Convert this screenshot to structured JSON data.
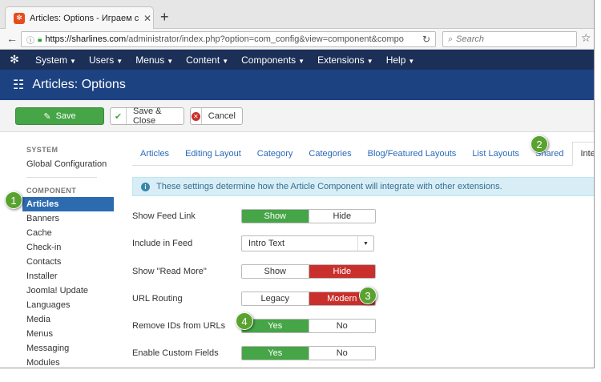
{
  "browser": {
    "tab_title": "Articles: Options - Играем с",
    "tab_icon": "joomla-favicon",
    "new_tab": "+",
    "url_host": "https://sharlines.com",
    "url_path": "/administrator/index.php?option=com_config&view=component&compo",
    "search_placeholder": "Search"
  },
  "menu": {
    "items": [
      "System",
      "Users",
      "Menus",
      "Content",
      "Components",
      "Extensions",
      "Help"
    ]
  },
  "header": {
    "title": "Articles: Options"
  },
  "toolbar": {
    "save_label": "Save",
    "save_close_label": "Save & Close",
    "cancel_label": "Cancel"
  },
  "sidebar": {
    "system_heading": "SYSTEM",
    "global_config": "Global Configuration",
    "component_heading": "COMPONENT",
    "items": [
      "Articles",
      "Banners",
      "Cache",
      "Check-in",
      "Contacts",
      "Installer",
      "Joomla! Update",
      "Languages",
      "Media",
      "Menus",
      "Messaging",
      "Modules"
    ]
  },
  "tabs": [
    "Articles",
    "Editing Layout",
    "Category",
    "Categories",
    "Blog/Featured Layouts",
    "List Layouts",
    "Shared",
    "Integration"
  ],
  "info": "These settings determine how the Article Component will integrate with other extensions.",
  "fields": {
    "feed_link": {
      "label": "Show Feed Link",
      "options": [
        "Show",
        "Hide"
      ],
      "selected": "Show"
    },
    "include_feed": {
      "label": "Include in Feed",
      "value": "Intro Text"
    },
    "read_more": {
      "label": "Show \"Read More\"",
      "options": [
        "Show",
        "Hide"
      ],
      "selected": "Hide"
    },
    "url_routing": {
      "label": "URL Routing",
      "options": [
        "Legacy",
        "Modern"
      ],
      "selected": "Modern"
    },
    "remove_ids": {
      "label": "Remove IDs from URLs",
      "options": [
        "Yes",
        "No"
      ],
      "selected": "Yes"
    },
    "custom_fields": {
      "label": "Enable Custom Fields",
      "options": [
        "Yes",
        "No"
      ],
      "selected": "Yes"
    }
  },
  "callouts": [
    "1",
    "2",
    "3",
    "4"
  ],
  "colors": {
    "menubar": "#1b2f57",
    "header": "#1d4281",
    "active_green": "#46a546",
    "active_red": "#c9302c",
    "callout": "#5aa230"
  }
}
